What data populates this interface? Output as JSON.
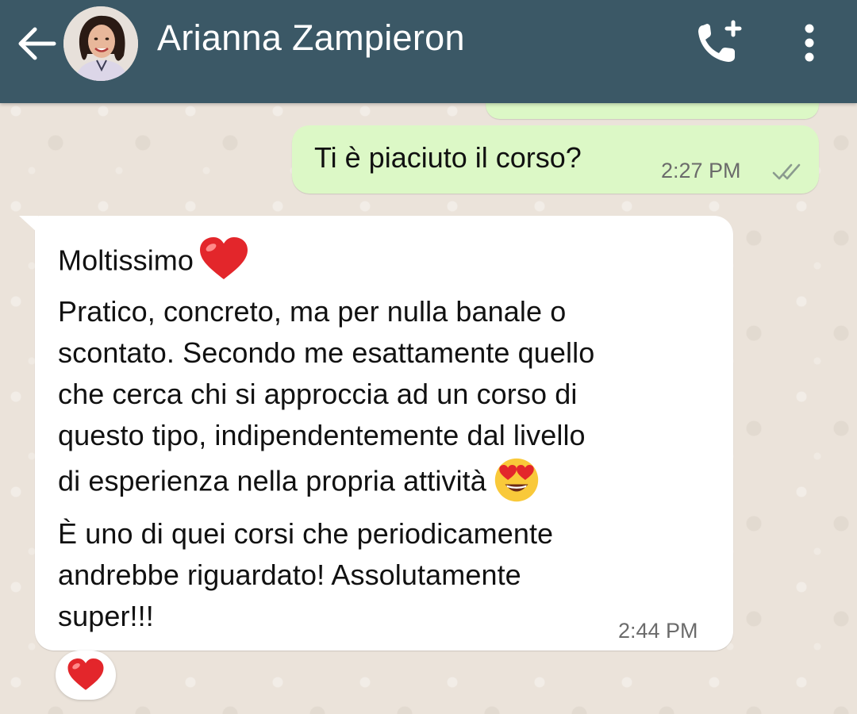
{
  "header": {
    "contact_name": "Arianna Zampieron",
    "icons": [
      "back-arrow-icon",
      "avatar",
      "add-call-icon",
      "more-vertical-icon"
    ],
    "background_color": "#3b5866"
  },
  "messages": {
    "outgoing": {
      "text": "Ti è piaciuto il corso?",
      "time": "2:27 PM",
      "status": "read",
      "bubble_color": "#dcf8c6"
    },
    "incoming": {
      "lines": [
        "Moltissimo",
        "Pratico, concreto, ma per nulla banale o",
        "scontato. Secondo me esattamente quello",
        "che cerca chi si approccia ad un corso di",
        "questo tipo, indipendentemente dal livello",
        "di esperienza nella propria attività",
        "È uno di quei corsi che periodicamente",
        "andrebbe riguardato! Assolutamente",
        "super!!!"
      ],
      "time": "2:44 PM",
      "emojis": [
        "red-heart-emoji",
        "heart-eyes-emoji"
      ],
      "bubble_color": "#ffffff"
    },
    "reaction": "red-heart-emoji"
  }
}
